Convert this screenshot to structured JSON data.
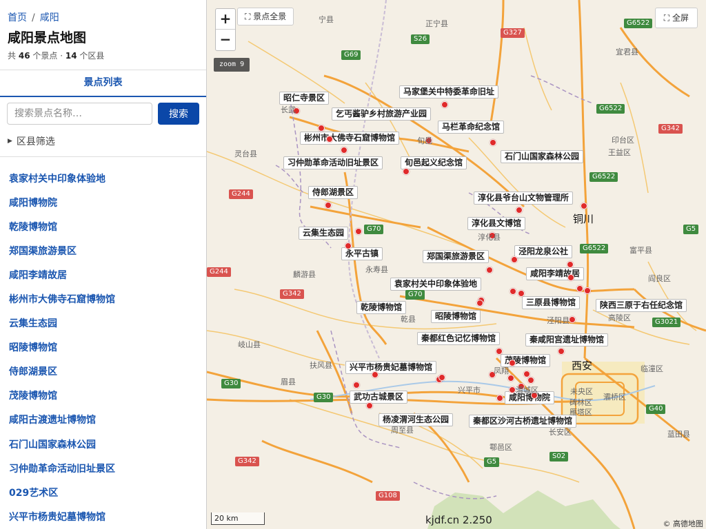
{
  "breadcrumb": {
    "home": "首页",
    "separator": "/",
    "current": "咸阳"
  },
  "page_title": "咸阳景点地图",
  "summary": {
    "prefix": "共",
    "spot_count": "46",
    "spot_unit": "个景点 ·",
    "county_count": "14",
    "county_unit": "个区县"
  },
  "tabs": {
    "list": "景点列表"
  },
  "search": {
    "placeholder": "搜索景点名称…",
    "button": "搜索"
  },
  "filter": {
    "label": "区县筛选"
  },
  "spots": [
    "袁家村关中印象体验地",
    "咸阳博物院",
    "乾陵博物馆",
    "郑国渠旅游景区",
    "咸阳李靖故居",
    "彬州市大佛寺石窟博物馆",
    "云集生态园",
    "昭陵博物馆",
    "侍郎湖景区",
    "茂陵博物馆",
    "咸阳古渡遗址博物馆",
    "石门山国家森林公园",
    "习仲勋革命活动旧址景区",
    "029艺术区",
    "兴平市杨贵妃墓博物馆"
  ],
  "map": {
    "zoom_in": "+",
    "zoom_out": "−",
    "full_view": "景点全景",
    "fullscreen": "全屏",
    "zoom_level": "zoom 9",
    "scale": "20 km",
    "brand": "kjdf.cn 2.250",
    "attribution": "© 高德地图",
    "city": "西安",
    "tongchuan": "铜川",
    "labels": [
      "昭仁寺景区",
      "马家堡关中特委革命旧址",
      "乞丐酱驴乡村旅游产业园",
      "马栏革命纪念馆",
      "彬州市大佛寺石窟博物馆",
      "石门山国家森林公园",
      "习仲勋革命活动旧址景区",
      "旬邑起义纪念馆",
      "侍郎湖景区",
      "淳化县爷台山文物管理所",
      "淳化县文博馆",
      "云集生态园",
      "永平古镇",
      "泾阳龙泉公社",
      "郑国渠旅游景区",
      "咸阳李靖故居",
      "袁家村关中印象体验地",
      "乾陵博物馆",
      "三原县博物馆",
      "陕西三原于右任纪念馆",
      "昭陵博物馆",
      "秦都红色记忆博物馆",
      "秦咸阳宫遗址博物馆",
      "兴平市杨贵妃墓博物馆",
      "茂陵博物馆",
      "武功古城景区",
      "咸阳博物院",
      "杨凌渭河生态公园",
      "秦都区沙河古桥遗址博物馆"
    ],
    "places": [
      "宁县",
      "正宁县",
      "宜君县",
      "长武",
      "旬邑",
      "印台区",
      "王益区",
      "灵台县",
      "淳化县",
      "永寿县",
      "富平县",
      "麟游县",
      "阎良区",
      "乾县",
      "泾阳县",
      "高陵区",
      "岐山县",
      "扶风县",
      "临潼区",
      "凤翔",
      "眉县",
      "兴平市",
      "周至县",
      "长安区",
      "鄠邑区",
      "蓝田县",
      "碑林区",
      "雁塔区",
      "未央区",
      "灞桥区",
      "渭城区"
    ],
    "shields": [
      "G327",
      "S26",
      "G69",
      "G6522",
      "G6522",
      "G342",
      "G6522",
      "G244",
      "G70",
      "G5",
      "G6522",
      "G244",
      "G342",
      "G70",
      "G3021",
      "G30",
      "G30",
      "G40",
      "S02",
      "G5",
      "G342",
      "G108"
    ]
  }
}
